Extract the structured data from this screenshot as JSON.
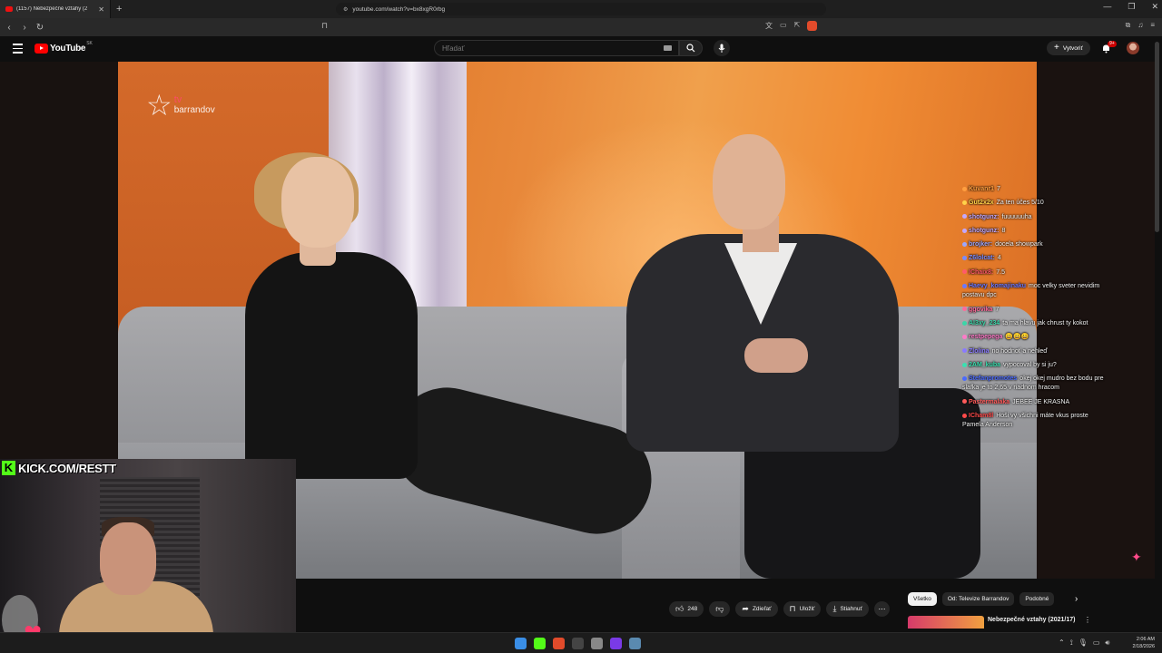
{
  "browser": {
    "tab_title": "(1157) Nebezpečné vztahy (2",
    "url": "youtube.com/watch?v=bx8xgR0rbg"
  },
  "youtube": {
    "logo_text": "YouTube",
    "logo_region": "SK",
    "search_placeholder": "Hľadať",
    "create_label": "Vytvoriť",
    "notification_count": "9+"
  },
  "video": {
    "watermark_tv": "tv",
    "watermark_channel": "barrandov"
  },
  "chat": [
    {
      "user": "Kuvanr1",
      "text": "7",
      "color": "#ff9f40"
    },
    {
      "user": "Gut2x2x",
      "text": "Za ten účes 5/10",
      "color": "#ffd24a"
    },
    {
      "user": "shotgunz:",
      "text": "fuuuuuuha",
      "color": "#c2a8ff"
    },
    {
      "user": "shotgunz:",
      "text": "8",
      "color": "#c2a8ff"
    },
    {
      "user": "brojker:",
      "text": "docela showpark",
      "color": "#9ba7ff"
    },
    {
      "user": "Z6lolcat:",
      "text": "4",
      "color": "#7a8cff"
    },
    {
      "user": "IChaix8:",
      "text": "7.5",
      "color": "#ff5a6a"
    },
    {
      "user": "Haevy_komajinaku",
      "text": "moc velky sveter nevidim postavu dpc",
      "color": "#6a78ff"
    },
    {
      "user": "ggovika",
      "text": "7",
      "color": "#ff6a9a"
    },
    {
      "user": "AI3xy_234",
      "text": "ta ma hlavu jak chrust ty kokot",
      "color": "#3ad6a8"
    },
    {
      "user": "restpepega",
      "text": "😀😀😀",
      "color": "#ff7ac8"
    },
    {
      "user": "Zlolina",
      "text": "no hodnoť a nehleď",
      "color": "#8a7aff"
    },
    {
      "user": "2AM_kuba",
      "text": "vypocoval by si ju?",
      "color": "#3ae0b0"
    },
    {
      "user": "Stefanpromotes",
      "text": "okej okej mudro bez bodu pre slafka je to 2,65 v riadnom hracom",
      "color": "#4a6aff"
    },
    {
      "user": "Pastermalaka",
      "text": "JEBEE JE KRASNA",
      "color": "#ff5a5a"
    },
    {
      "user": "ICham8l",
      "text": "Hoši vy všichni máte vkus proste Pamela Anderson",
      "color": "#ff4a4a"
    }
  ],
  "webcam": {
    "kick_badge": "K",
    "kick_url": "KICK.COM/RESTT"
  },
  "actions": {
    "like_count": "248",
    "share_label": "Zdieľať",
    "save_label": "Uložiť",
    "download_label": "Stiahnuť"
  },
  "chips": [
    "Všetko",
    "Od: Televize Barrandov",
    "Podobné"
  ],
  "recommendation": {
    "title": "Nebezpečné vztahy (2021/17)"
  },
  "taskbar": {
    "time": "2:06 AM",
    "date": "2/18/2026"
  },
  "colors": {
    "youtube_red": "#ff0000",
    "kick_green": "#53fc18",
    "background": "#0f0f0f"
  }
}
